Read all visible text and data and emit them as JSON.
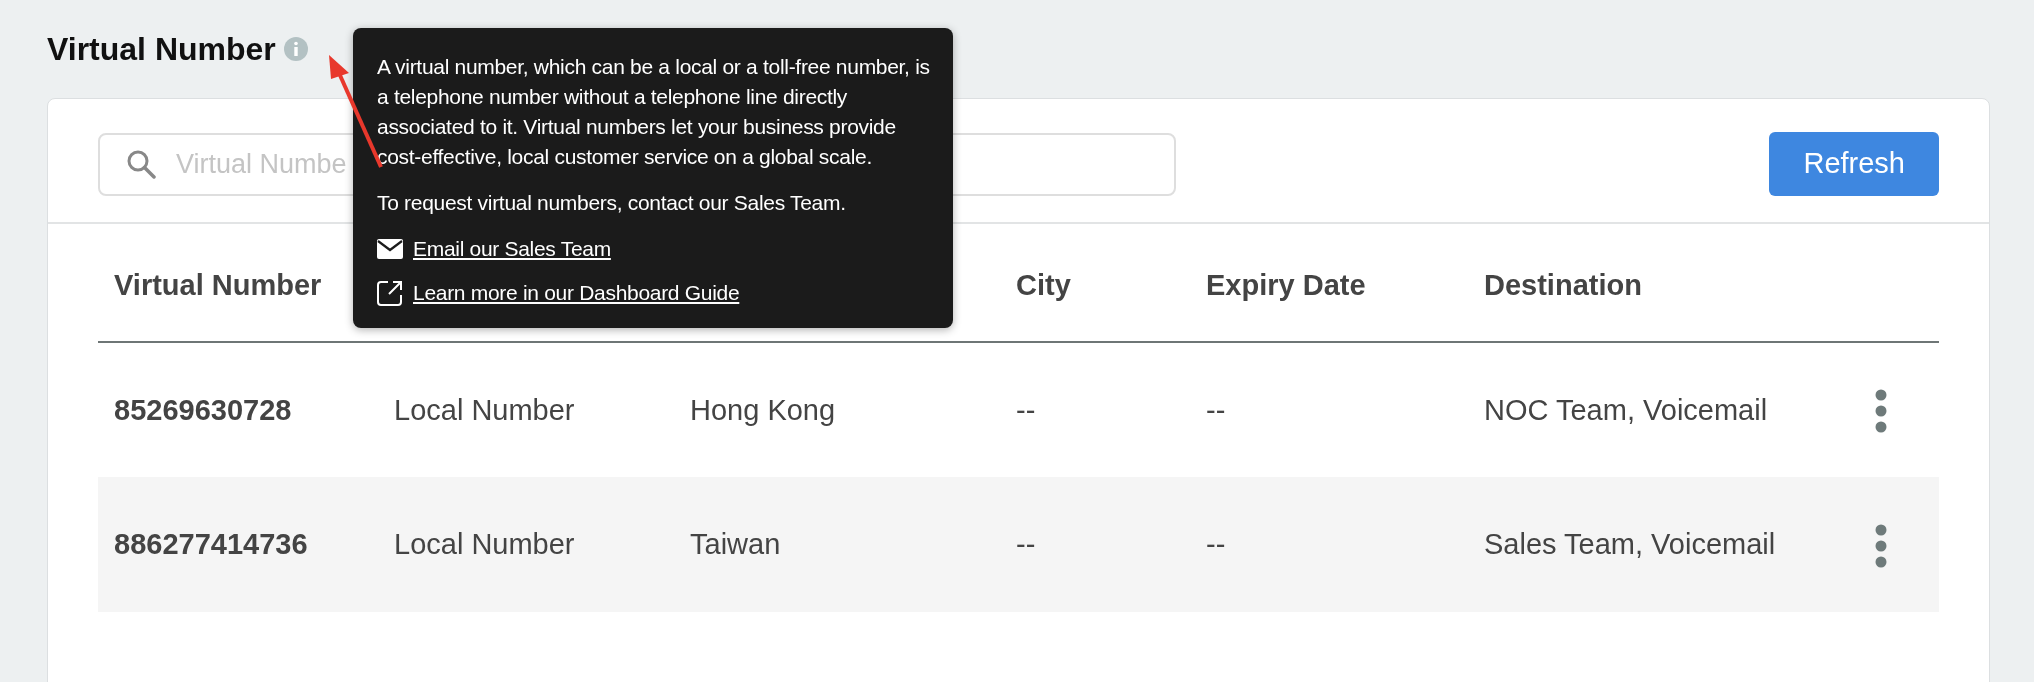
{
  "page": {
    "title": "Virtual Number"
  },
  "search": {
    "placeholder": "Virtual Numbe"
  },
  "refresh_button": {
    "label": "Refresh"
  },
  "table": {
    "columns": [
      {
        "label": "Virtual Number"
      },
      {},
      {},
      {
        "label": "City"
      },
      {
        "label": "Expiry Date"
      },
      {
        "label": "Destination"
      }
    ],
    "rows": [
      {
        "cells": [
          "85269630728",
          "Local Number",
          "Hong Kong",
          "--",
          "--",
          "NOC Team, Voicemail"
        ]
      },
      {
        "cells": [
          "886277414736",
          "Local Number",
          "Taiwan",
          "--",
          "--",
          "Sales Team, Voicemail"
        ]
      }
    ]
  },
  "tooltip": {
    "paragraphs": [
      "A virtual number, which can be a local or a toll-free number, is a telephone number without a telephone line directly associated to it. Virtual numbers let your business provide cost-effective, local customer service on a global scale.",
      "To request virtual numbers, contact our Sales Team."
    ],
    "links": [
      {
        "kind": "email",
        "label": "Email our Sales Team"
      },
      {
        "kind": "external",
        "label": "Learn more in our Dashboard Guide"
      }
    ]
  }
}
